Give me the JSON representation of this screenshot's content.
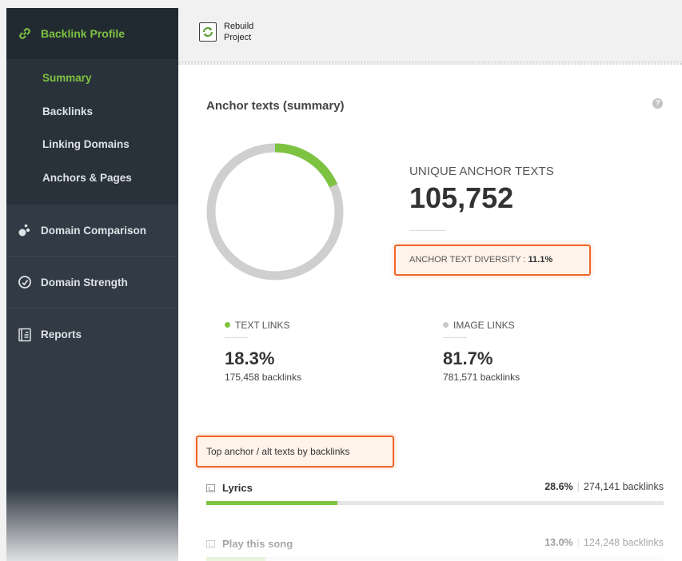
{
  "sidebar": {
    "header_label": "Backlink Profile",
    "sub_items": [
      "Summary",
      "Backlinks",
      "Linking Domains",
      "Anchors & Pages"
    ],
    "groups": [
      "Domain Comparison",
      "Domain Strength",
      "Reports"
    ]
  },
  "toolbar": {
    "rebuild_label": "Rebuild Project"
  },
  "summary": {
    "title": "Anchor texts (summary)",
    "help": "?",
    "unique_label": "UNIQUE ANCHOR TEXTS",
    "unique_value": "105,752",
    "diversity_label": "ANCHOR TEXT DIVERSITY : ",
    "diversity_value": "11.1%",
    "donut_fraction": 0.183,
    "text_links": {
      "label": "TEXT LINKS",
      "pct": "18.3%",
      "backlinks": "175,458 backlinks",
      "color": "#7ec242"
    },
    "image_links": {
      "label": "IMAGE LINKS",
      "pct": "81.7%",
      "backlinks": "781,571 backlinks",
      "color": "#c8c8c8"
    }
  },
  "top_anchors": {
    "title": "Top anchor / alt texts by backlinks",
    "rows": [
      {
        "name": "Lyrics",
        "pct": "28.6%",
        "backlinks": "274,141 backlinks",
        "fraction": 0.286
      },
      {
        "name": "Play this song",
        "pct": "13.0%",
        "backlinks": "124,248 backlinks",
        "fraction": 0.13
      }
    ]
  },
  "colors": {
    "accent": "#7ec242",
    "highlight": "#f0662a",
    "sidebar": "#323b45"
  }
}
